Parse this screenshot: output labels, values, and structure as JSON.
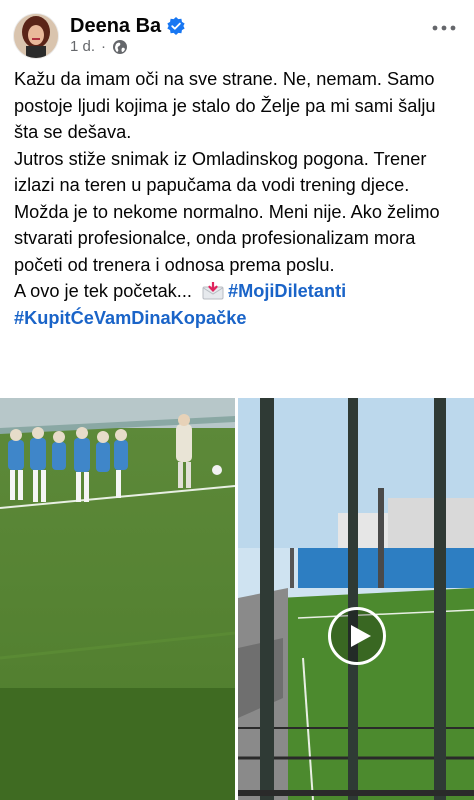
{
  "post": {
    "author": "Deena Ba",
    "time": "1 d.",
    "paragraphs": [
      "Kažu da imam oči na sve strane. Ne, nemam. Samo postoje ljudi kojima je stalo do Želje pa mi sami šalju šta se dešava.",
      "Jutros stiže snimak iz Omladinskog pogona. Trener izlazi na teren u papučama da vodi trening djece.",
      "Možda je to nekome normalno. Meni nije. Ako želimo stvarati profesionalce, onda profesionalizam mora početi od trenera i odnosa prema poslu."
    ],
    "last_line": "A ovo je tek početak...",
    "hashtag1": "#MojiDiletanti",
    "hashtag2": "#KupitĆeVamDinaKopačke"
  },
  "colors": {
    "accent": "#1a64c8",
    "meta": "#65676b"
  },
  "icons": [
    "verified-icon",
    "globe-icon",
    "more-options-icon",
    "incoming-envelope-icon",
    "play-icon"
  ]
}
